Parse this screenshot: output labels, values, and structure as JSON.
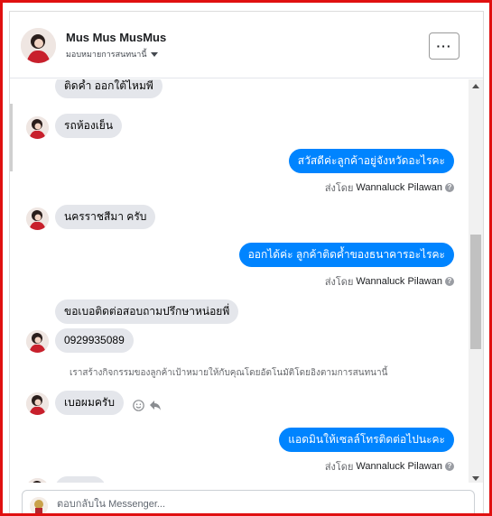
{
  "header": {
    "name": "Mus Mus MusMus",
    "subtitle": "มอบหมายการสนทนานี้",
    "more_label": "···"
  },
  "messages": [
    {
      "type": "incoming",
      "text": "ติดค้ำ ออกใต้ไหมพี่"
    },
    {
      "type": "incoming",
      "text": "รถห้องเย็น"
    },
    {
      "type": "outgoing",
      "text": "สวัสดีค่ะลูกค้าอยู่จังหวัดอะไรคะ"
    },
    {
      "type": "outgoing",
      "text": "ออกได้ค่ะ  ลูกค้าติดค้ำของธนาคารอะไรคะ"
    },
    {
      "type": "incoming",
      "text": "นครราชสีมา ครับ"
    },
    {
      "type": "incoming",
      "text": "ขอเบอติดต่อสอบถามปรึกษาหน่อยพี่"
    },
    {
      "type": "incoming",
      "text": "0929935089"
    },
    {
      "type": "incoming",
      "text": "เบอผมครับ"
    },
    {
      "type": "outgoing",
      "text": "แอดมินให้เซลล์โทรติดต่อไปนะคะ"
    }
  ],
  "sent_by": {
    "prefix": "ส่งโดย",
    "agent": "Wannaluck Pilawan"
  },
  "notice": "เราสร้างกิจกรรมของลูกค้าเป้าหมายให้กับคุณโดยอัตโนมัติโดยอิงตามการสนทนานี้",
  "composer": {
    "placeholder": "ตอบกลับใน Messenger..."
  },
  "colors": {
    "outgoing_bubble": "#0084ff",
    "incoming_bubble": "#e4e6eb",
    "frame_border": "#e01010"
  },
  "icons": [
    "more-options-icon",
    "caret-down-icon",
    "help-icon",
    "emoji-icon",
    "reply-icon",
    "scroll-up-icon",
    "scroll-down-icon"
  ]
}
